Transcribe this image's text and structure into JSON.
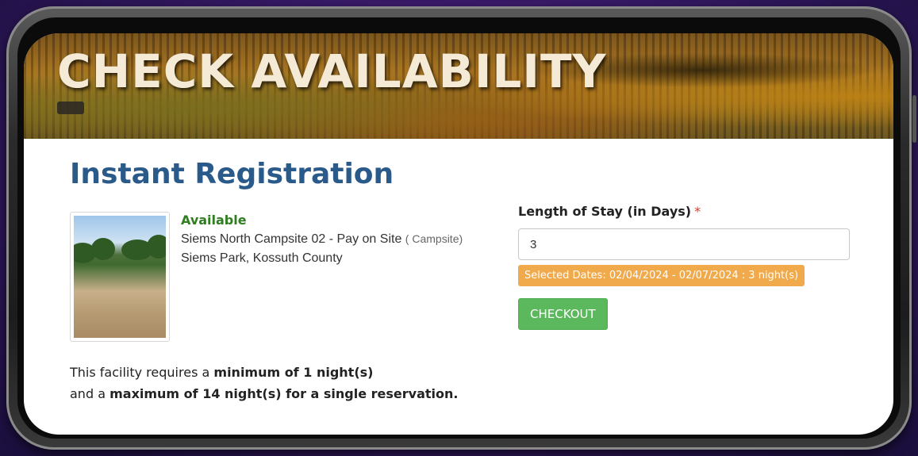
{
  "banner": {
    "title": "CHECK AVAILABILITY"
  },
  "page": {
    "heading": "Instant Registration"
  },
  "site": {
    "status": "Available",
    "name": "Siems North Campsite 02 - Pay on Site",
    "type": "( Campsite)",
    "location": "Siems Park, Kossuth County"
  },
  "form": {
    "length_label": "Length of Stay (in Days)",
    "required_marker": "*",
    "length_value": "3",
    "selected_dates": "Selected Dates: 02/04/2024 - 02/07/2024 : 3 night(s)",
    "checkout_label": "CHECKOUT"
  },
  "rules": {
    "line1_prefix": "This facility requires a",
    "line1_bold": "minimum of 1 night(s)",
    "line2_prefix": "and a",
    "line2_bold": "maximum of 14 night(s) for a single reservation."
  },
  "colors": {
    "heading": "#2a5a8a",
    "available": "#2e7d1f",
    "dates_badge": "#f0a94b",
    "checkout": "#5cb85c"
  }
}
